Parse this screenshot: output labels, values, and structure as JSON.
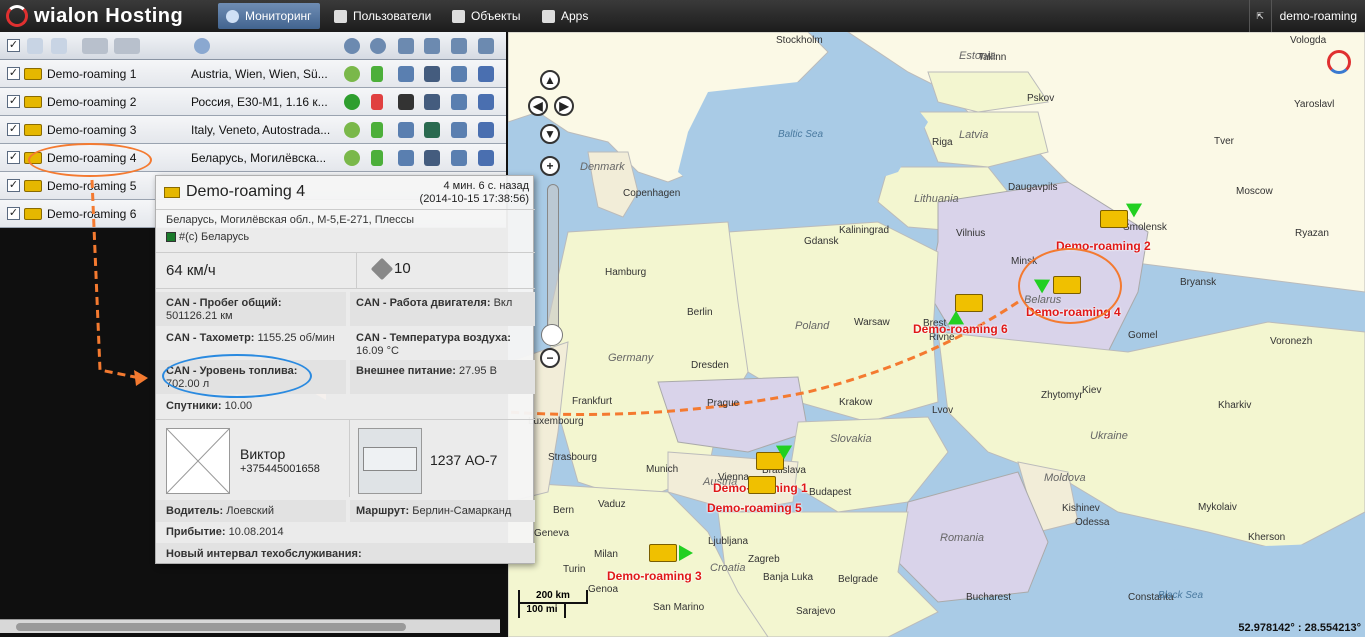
{
  "topbar": {
    "logo_text": "wialon Hosting",
    "menu": [
      {
        "label": "Мониторинг",
        "icon": "globe-icon"
      },
      {
        "label": "Пользователи",
        "icon": "users-icon"
      },
      {
        "label": "Объекты",
        "icon": "objects-icon"
      },
      {
        "label": "Apps",
        "icon": "apps-icon"
      }
    ],
    "user": "demo-roaming"
  },
  "unit_list": {
    "header_icons": [
      "sort-az-icon",
      "list-icon",
      "add-group-icon",
      "toggle-icon",
      "locate-icon",
      "commands-icon",
      "gps-icon",
      "driver-icon",
      "trailer-icon",
      "tools-icon",
      "report-icon"
    ],
    "units": [
      {
        "name": "Demo-roaming 1",
        "location": "Austria, Wien, Wien, Sü..."
      },
      {
        "name": "Demo-roaming 2",
        "location": "Россия, E30-M1, 1.16 к..."
      },
      {
        "name": "Demo-roaming 3",
        "location": "Italy, Veneto, Autostrada..."
      },
      {
        "name": "Demo-roaming 4",
        "location": "Беларусь, Могилёвска..."
      },
      {
        "name": "Demo-roaming 5",
        "location": ""
      },
      {
        "name": "Demo-roaming 6",
        "location": ""
      }
    ]
  },
  "popup": {
    "title": "Demo-roaming 4",
    "ago": "4 мин. 6 с. назад",
    "timestamp": "(2014-10-15 17:38:56)",
    "address": "Беларусь, Могилёвская обл., М-5,E-271, Плессы",
    "country": "#(c) Беларусь",
    "speed": "64 км/ч",
    "satellites_count": "10",
    "params": [
      {
        "label": "CAN - Пробег общий:",
        "value": "501126.21 км"
      },
      {
        "label": "CAN - Работа двигателя:",
        "value": "Вкл"
      },
      {
        "label": "CAN - Тахометр:",
        "value": "1155.25 об/мин"
      },
      {
        "label": "CAN - Температура воздуха:",
        "value": "16.09 °C"
      },
      {
        "label": "CAN - Уровень топлива:",
        "value": "702.00 л"
      },
      {
        "label": "Внешнее питание:",
        "value": "27.95 В"
      },
      {
        "label": "Спутники:",
        "value": "10.00"
      }
    ],
    "driver_name": "Виктор",
    "driver_phone": "+375445001658",
    "trailer_number": "1237 АО-7",
    "driver_label": "Водитель:",
    "driver_value": "Лоевский",
    "route_label": "Маршрут:",
    "route_value": "Берлин-Самарканд",
    "arrival_label": "Прибытие:",
    "arrival_value": "10.08.2014",
    "service_label": "Новый интервал техобслуживания:"
  },
  "map": {
    "cities": [
      "Stockholm",
      "Vologda",
      "Pskov",
      "Yaroslavl",
      "Tver",
      "Moscow",
      "Ryazan",
      "Bryansk",
      "Voronezh",
      "Riga",
      "Vilnius",
      "Minsk",
      "Kaliningrad",
      "Gdansk",
      "Copenhagen",
      "Hamburg",
      "Berlin",
      "Warsaw",
      "Dresden",
      "Prague",
      "Krakow",
      "Lvov",
      "Rivne",
      "Zhytomyr",
      "Kiev",
      "Kharkiv",
      "Frankfurt",
      "Munich",
      "Bratislava",
      "Budapest",
      "Vienna",
      "Kishinev",
      "Odessa",
      "Bern",
      "Vaduz",
      "Milan",
      "Ljubljana",
      "Zagreb",
      "Banja Luka",
      "Belgrade",
      "Sarajevo",
      "Bucharest",
      "Genoa",
      "San Marino",
      "Constanta",
      "Strasbourg",
      "Luxembourg",
      "Geneva",
      "Turin",
      "Kherson",
      "Mykolaiv",
      "Gomel",
      "Brest",
      "Daugavpils",
      "Tallinn",
      "Smolensk"
    ],
    "seas": [
      "Baltic Sea",
      "Black Sea"
    ],
    "countries": [
      "Estonia",
      "Latvia",
      "Lithuania",
      "Belarus",
      "Poland",
      "Germany",
      "Denmark",
      "Slovakia",
      "Austria",
      "Ukraine",
      "Moldova",
      "Romania",
      "Croatia"
    ],
    "unit_labels": [
      "Demo-roaming 1",
      "Demo-roaming 2",
      "Demo-roaming 3",
      "Demo-roaming 4",
      "Demo-roaming 5",
      "Demo-roaming 6"
    ],
    "scale_km": "200 km",
    "scale_mi": "100 mi",
    "coordinates": "52.978142° : 28.554213°"
  }
}
